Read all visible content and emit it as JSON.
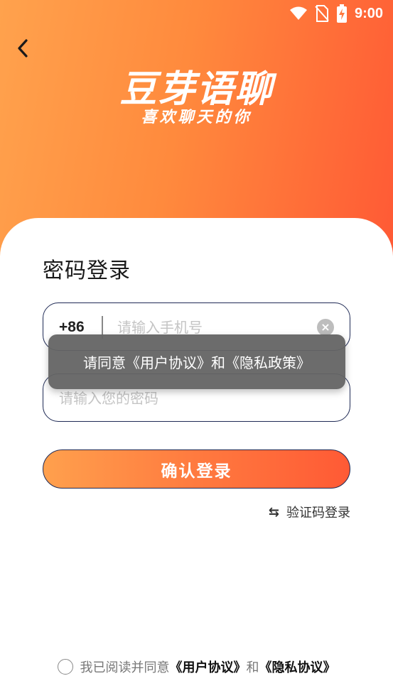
{
  "status_bar": {
    "time": "9:00"
  },
  "header": {
    "app_name": "豆芽语聊",
    "slogan": "喜欢聊天的你"
  },
  "page": {
    "title": "密码登录"
  },
  "phone_field": {
    "country_code": "+86",
    "placeholder": "请输入手机号",
    "value": "",
    "clear_icon": "×"
  },
  "password_field": {
    "placeholder": "请输入您的密码",
    "value": ""
  },
  "toast": {
    "message": "请同意《用户协议》和《隐私政策》"
  },
  "actions": {
    "login_label": "确认登录",
    "switch_icon": "⇆",
    "switch_label": "验证码登录"
  },
  "agreement": {
    "prefix": "我已阅读并同意",
    "user_agreement": "《用户协议》",
    "conjunction": "和",
    "privacy": "《隐私协议》",
    "checked": false
  },
  "colors": {
    "gradient_start": "#ffa24d",
    "gradient_end": "#ff5a35",
    "field_border": "#1f2a55",
    "toast_bg": "#646464"
  },
  "icons": [
    "wifi-icon",
    "no-sim-icon",
    "battery-charging-icon",
    "back-arrow-icon",
    "clear-icon",
    "switch-arrows-icon"
  ]
}
